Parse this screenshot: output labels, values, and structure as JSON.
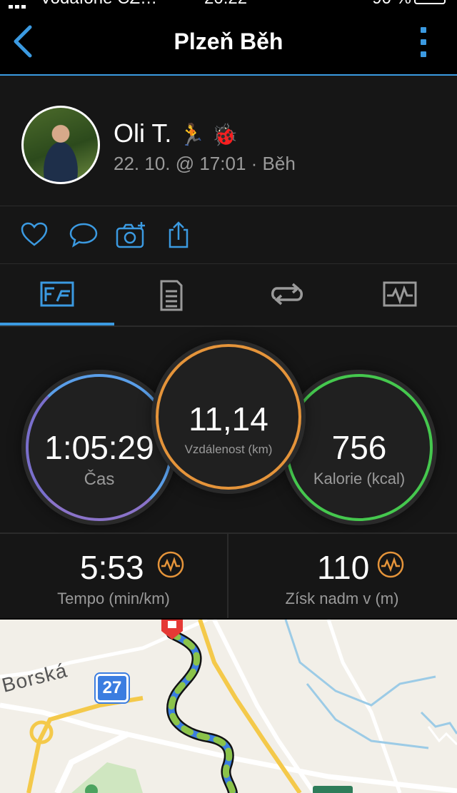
{
  "status_bar": {
    "carrier": "Vodafone CZ…",
    "time": "20:22",
    "battery": "90 %"
  },
  "nav": {
    "title": "Plzeň Běh"
  },
  "profile": {
    "name": "Oli T.",
    "emoji": "🏃 🐞",
    "meta": "22. 10. @ 17:01 · Běh"
  },
  "stats": {
    "time": {
      "value": "1:05:29",
      "label": "Čas"
    },
    "distance": {
      "value": "11,14",
      "label": "Vzdálenost (km)"
    },
    "calories": {
      "value": "756",
      "label": "Kalorie (kcal)"
    }
  },
  "metrics": {
    "pace": {
      "value": "5:53",
      "label": "Tempo (min/km)"
    },
    "elevation": {
      "value": "110",
      "label": "Získ nadm v (m)"
    }
  },
  "map": {
    "street_label": "Borská",
    "road_number": "27"
  },
  "colors": {
    "accent": "#3b9ae1",
    "orange": "#e5943a",
    "green": "#45c84e",
    "purple": "#8a73c9"
  },
  "icons": [
    "back-icon",
    "more-icon",
    "like-icon",
    "comment-icon",
    "add-photo-icon",
    "share-icon",
    "map-stats-icon",
    "details-icon",
    "laps-icon",
    "chart-icon",
    "insight-icon"
  ]
}
